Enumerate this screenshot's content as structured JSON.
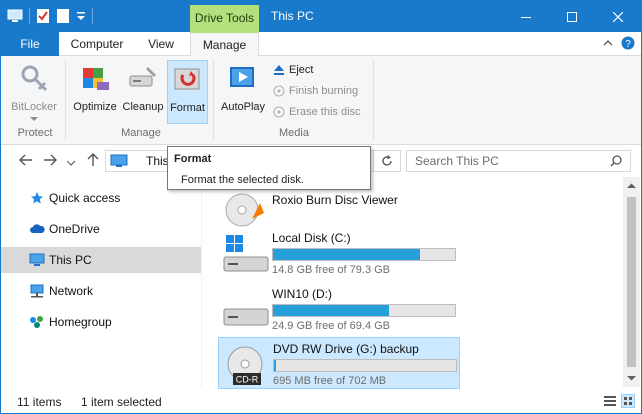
{
  "window": {
    "title": "This PC",
    "context_tab": "Drive Tools",
    "accent": "#1979ca",
    "context_color": "#b3e07d"
  },
  "tabs": {
    "file": "File",
    "computer": "Computer",
    "view": "View",
    "manage": "Manage"
  },
  "ribbon": {
    "bitlocker": "BitLocker",
    "optimize": "Optimize",
    "cleanup": "Cleanup",
    "format": "Format",
    "autoplay": "AutoPlay",
    "eject": "Eject",
    "finish_burning": "Finish burning",
    "erase_disc": "Erase this disc",
    "group_protect": "Protect",
    "group_manage": "Manage",
    "group_media": "Media"
  },
  "address": {
    "path": "This PC",
    "search_placeholder": "Search This PC"
  },
  "tooltip": {
    "title": "Format",
    "description": "Format the selected disk."
  },
  "nav": {
    "items": [
      {
        "label": "Quick access",
        "icon": "star-icon"
      },
      {
        "label": "OneDrive",
        "icon": "cloud-icon"
      },
      {
        "label": "This PC",
        "icon": "computer-icon"
      },
      {
        "label": "Network",
        "icon": "network-icon"
      },
      {
        "label": "Homegroup",
        "icon": "homegroup-icon"
      }
    ]
  },
  "drives": [
    {
      "name": "Roxio Burn Disc Viewer"
    },
    {
      "name": "Local Disk (C:)",
      "free": "14.8 GB free of 79.3 GB",
      "used_fraction": 0.81
    },
    {
      "name": "WIN10 (D:)",
      "free": "24.9 GB free of 69.4 GB",
      "used_fraction": 0.64
    },
    {
      "name": "DVD RW Drive (G:) backup",
      "free": "695 MB free of 702 MB",
      "used_fraction": 0.01,
      "badge": "CD-R"
    }
  ],
  "status": {
    "items": "11 items",
    "selected": "1 item selected"
  }
}
